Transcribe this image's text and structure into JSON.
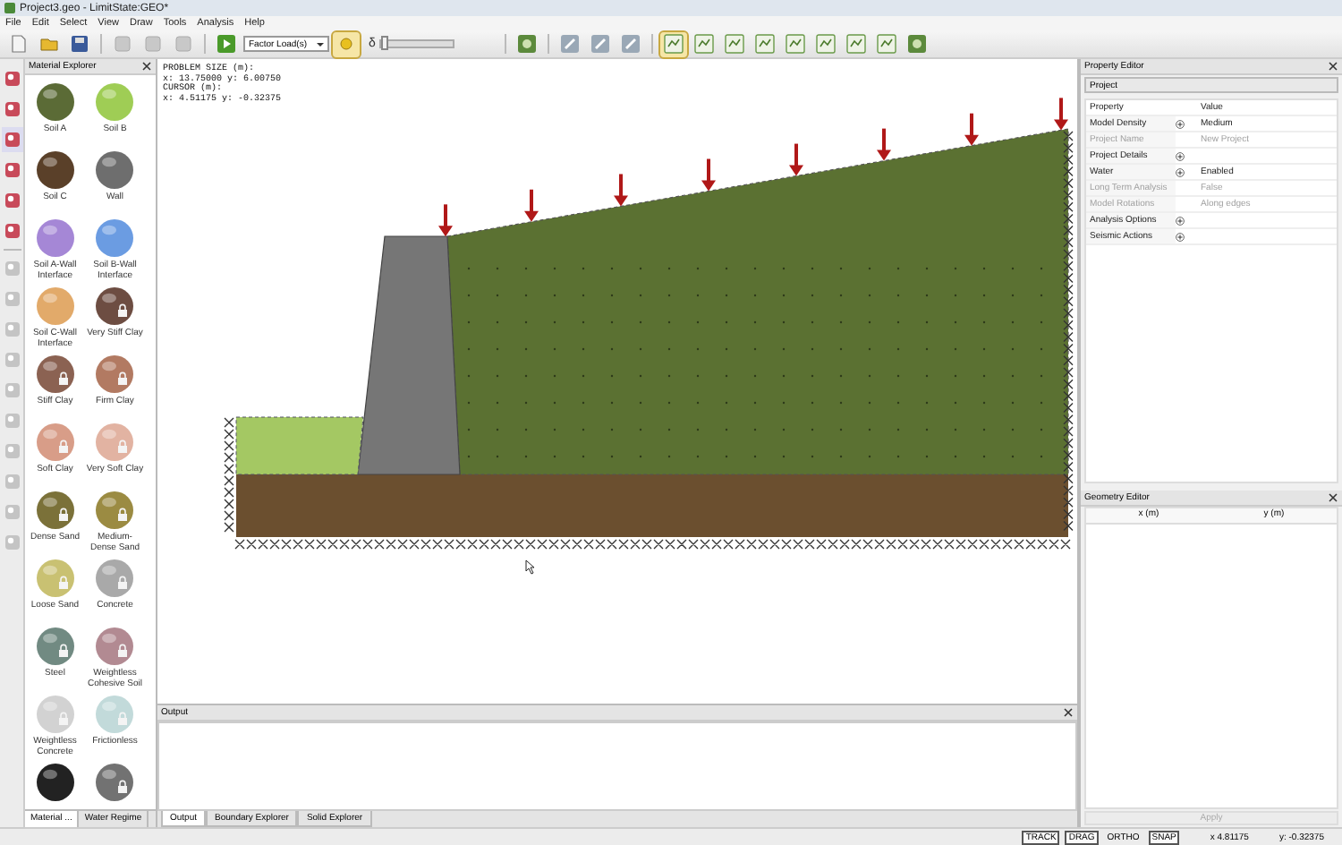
{
  "window": {
    "title": "Project3.geo - LimitState:GEO*"
  },
  "menu": [
    "File",
    "Edit",
    "Select",
    "View",
    "Draw",
    "Tools",
    "Analysis",
    "Help"
  ],
  "toolbar": {
    "load_dropdown": "Factor Load(s)",
    "snap_toggle_on": true,
    "delta_label": "δ",
    "delta_slider": {
      "level": 0.06
    }
  },
  "material_explorer": {
    "title": "Material Explorer",
    "materials": [
      {
        "label": "Soil A",
        "color": "#5b6b36",
        "locked": false
      },
      {
        "label": "Soil B",
        "color": "#9fcd55",
        "locked": false
      },
      {
        "label": "Soil C",
        "color": "#5a4029",
        "locked": false
      },
      {
        "label": "Wall",
        "color": "#6e6e6e",
        "locked": false
      },
      {
        "label": "Soil A-Wall Interface",
        "color": "#a587d6",
        "locked": false
      },
      {
        "label": "Soil B-Wall Interface",
        "color": "#6b9ce2",
        "locked": false
      },
      {
        "label": "Soil C-Wall Interface",
        "color": "#e2aa6a",
        "locked": false
      },
      {
        "label": "Very Stiff Clay",
        "color": "#6d4d42",
        "locked": true
      },
      {
        "label": "Stiff Clay",
        "color": "#8b6252",
        "locked": true
      },
      {
        "label": "Firm Clay",
        "color": "#b27a62",
        "locked": true
      },
      {
        "label": "Soft Clay",
        "color": "#d89d88",
        "locked": true
      },
      {
        "label": "Very Soft Clay",
        "color": "#e2b3a2",
        "locked": true
      },
      {
        "label": "Dense Sand",
        "color": "#7b7139",
        "locked": true
      },
      {
        "label": "Medium-Dense Sand",
        "color": "#9b8b42",
        "locked": true
      },
      {
        "label": "Loose Sand",
        "color": "#c9c172",
        "locked": true
      },
      {
        "label": "Concrete",
        "color": "#a9a9a9",
        "locked": true
      },
      {
        "label": "Steel",
        "color": "#718a82",
        "locked": true
      },
      {
        "label": "Weightless Cohesive Soil",
        "color": "#b28a92",
        "locked": true
      },
      {
        "label": "Weightless Concrete",
        "color": "#d2d2d2",
        "locked": true
      },
      {
        "label": "Frictionless",
        "color": "#c2dada",
        "locked": true
      },
      {
        "color": "#222222",
        "locked": false
      },
      {
        "color": "#727272",
        "locked": true
      }
    ],
    "tabs": [
      {
        "label": "Material ...",
        "selected": true
      },
      {
        "label": "Water Regime",
        "selected": false
      }
    ]
  },
  "canvas": {
    "info_lines": [
      "PROBLEM SIZE (m):",
      "x: 13.75000 y: 6.00750",
      "CURSOR (m):",
      "x: 4.51175 y: -0.32375"
    ]
  },
  "output": {
    "title": "Output",
    "tabs": [
      {
        "label": "Output",
        "selected": true
      },
      {
        "label": "Boundary Explorer",
        "selected": false
      },
      {
        "label": "Solid Explorer",
        "selected": false
      }
    ]
  },
  "property_editor": {
    "title": "Property Editor",
    "object": "Project",
    "columns": [
      "Property",
      "Value"
    ],
    "rows": [
      {
        "property": "Model Density",
        "value": "Medium",
        "expandable": true,
        "disabled": false
      },
      {
        "property": "Project Name",
        "value": "New Project",
        "expandable": false,
        "disabled": true
      },
      {
        "property": "Project Details",
        "value": "",
        "expandable": true,
        "disabled": false
      },
      {
        "property": "Water",
        "value": "Enabled",
        "expandable": true,
        "disabled": false
      },
      {
        "property": "Long Term Analysis",
        "value": "False",
        "expandable": false,
        "disabled": true
      },
      {
        "property": "Model Rotations",
        "value": "Along edges",
        "expandable": false,
        "disabled": true
      },
      {
        "property": "Analysis Options",
        "value": "",
        "expandable": true,
        "disabled": false
      },
      {
        "property": "Seismic Actions",
        "value": "",
        "expandable": true,
        "disabled": false
      }
    ]
  },
  "geometry_editor": {
    "title": "Geometry Editor",
    "columns": [
      "x (m)",
      "y (m)"
    ],
    "apply": "Apply"
  },
  "status_bar": {
    "toggles": [
      {
        "label": "TRACK",
        "on": true
      },
      {
        "label": "DRAG",
        "on": true
      },
      {
        "label": "ORTHO",
        "on": false
      },
      {
        "label": "SNAP",
        "on": true
      }
    ],
    "x": "x 4.81175",
    "y": "y: -0.32375"
  }
}
